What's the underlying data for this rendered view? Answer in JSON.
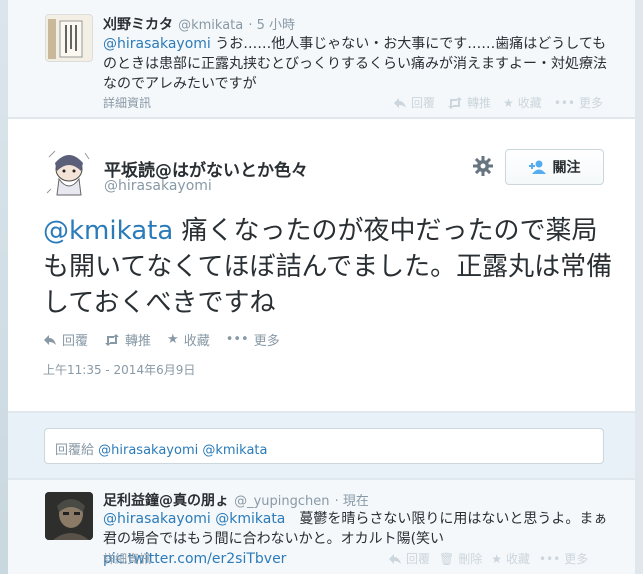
{
  "reply_tweet": {
    "name": "刈野ミカタ",
    "handle": "@kmikata",
    "time": "· 5 小時",
    "mention": "@hirasakayomi",
    "text": " うお……他人事じゃない・お大事にです……歯痛はどうしてものときは患部に正露丸挟むとびっくりするくらい痛みが消えますよー・対処療法なのでアレみたいですが",
    "details": "詳細資訊",
    "actions": {
      "reply": "回覆",
      "retweet": "轉推",
      "favorite": "收藏",
      "more": "更多"
    }
  },
  "main_tweet": {
    "name": "平坂読@はがないとか色々",
    "handle": "@hirasakayomi",
    "follow_label": "關注",
    "mention": "@kmikata",
    "text": " 痛くなったのが夜中だったので薬局も開いてなくてほぼ詰んでました。正露丸は常備しておくべきですね",
    "actions": {
      "reply": "回覆",
      "retweet": "轉推",
      "favorite": "收藏",
      "more": "更多"
    },
    "timestamp": "上午11:35 - 2014年6月9日"
  },
  "reply_box": {
    "prefix": "回覆給 ",
    "mention1": "@hirasakayomi",
    "mention2": " @kmikata"
  },
  "bottom_tweet": {
    "name": "足利益鐘@真の朋ょ",
    "handle": "@_yupingchen",
    "time": "· 現在",
    "mention1": "@hirasakayomi",
    "mention2": " @kmikata",
    "text": "　蔓鬱を晴らさない限りに用はないと思うよ。まぁ君の場合ではもう間に合わないかと。オカルト陽(笑い ",
    "link": "pic.twitter.com/er2siTbver",
    "details": "詳細資訊",
    "actions": {
      "reply": "回覆",
      "retweet": "轉推",
      "delete": "刪除",
      "favorite": "收藏",
      "more": "更多"
    }
  },
  "colors": {
    "accent": "#2b7bb9",
    "muted": "#8899a6",
    "text": "#292f33"
  }
}
